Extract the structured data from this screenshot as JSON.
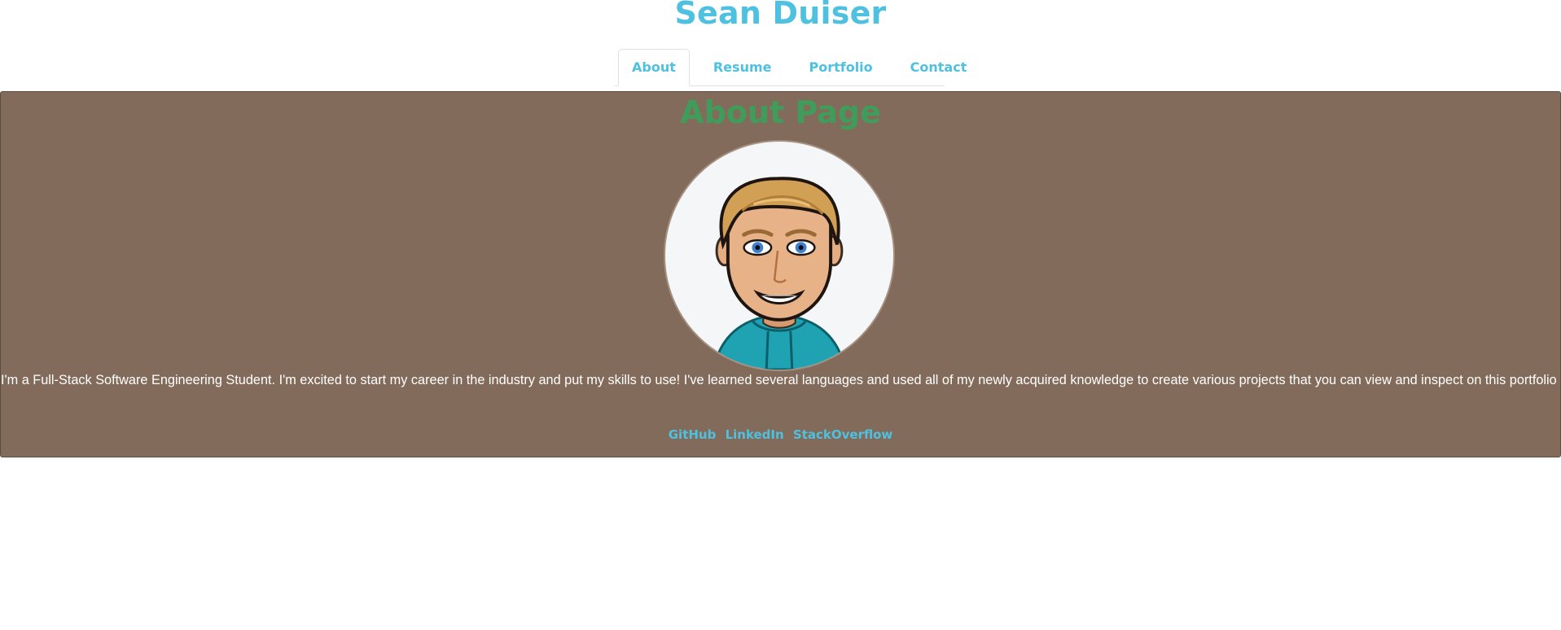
{
  "header": {
    "title": "Sean Duiser",
    "nav": [
      {
        "label": "About",
        "active": true
      },
      {
        "label": "Resume",
        "active": false
      },
      {
        "label": "Portfolio",
        "active": false
      },
      {
        "label": "Contact",
        "active": false
      }
    ]
  },
  "about": {
    "heading": "About Page",
    "avatar_icon": "bitmoji-avatar-icon",
    "bio": "I'm a Full-Stack Software Engineering Student. I'm excited to start my career in the industry and put my skills to use! I've learned several languages and used all of my newly acquired knowledge to create various projects that you can view and inspect on this portfolio page.",
    "links": [
      {
        "label": "GitHub"
      },
      {
        "label": "LinkedIn"
      },
      {
        "label": "StackOverflow"
      }
    ]
  },
  "colors": {
    "accent": "#4ec1e0",
    "section_bg": "#836b5b",
    "heading_green": "#3f9c5a"
  }
}
